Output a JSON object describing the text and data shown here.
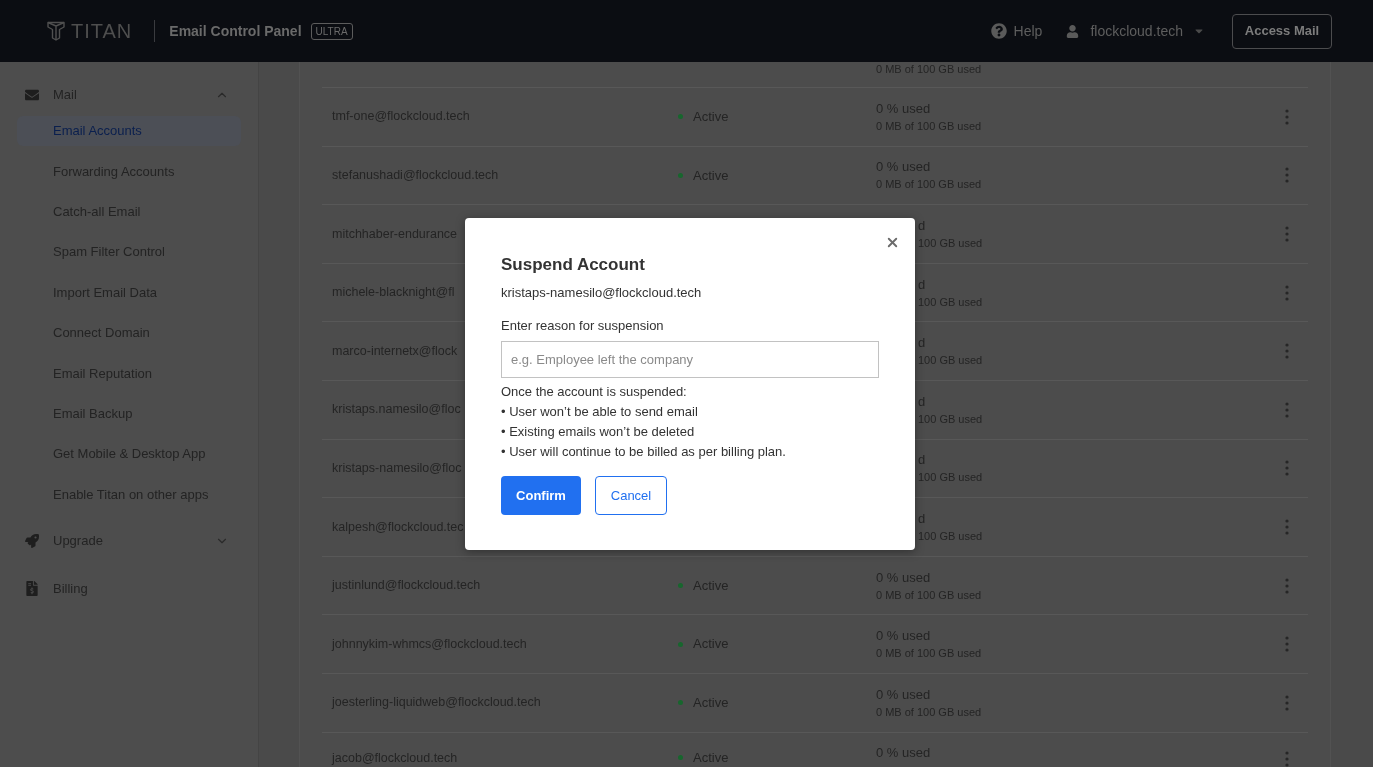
{
  "header": {
    "logo": {
      "text": "TITAN"
    },
    "title": "Email Control Panel",
    "badge": "ULTRA",
    "help": "Help",
    "account": "flockcloud.tech",
    "action": "Access Mail"
  },
  "sidebar": {
    "sections": [
      {
        "label": "Mail",
        "expanded": true,
        "items": [
          {
            "label": "Email Accounts",
            "selected": true
          },
          {
            "label": "Forwarding Accounts",
            "selected": false
          },
          {
            "label": "Catch-all Email",
            "selected": false
          },
          {
            "label": "Spam Filter Control",
            "selected": false
          },
          {
            "label": "Import Email Data",
            "selected": false
          },
          {
            "label": "Connect Domain",
            "selected": false
          },
          {
            "label": "Email Reputation",
            "selected": false
          },
          {
            "label": "Email Backup",
            "selected": false
          },
          {
            "label": "Get Mobile & Desktop App",
            "selected": false
          },
          {
            "label": "Enable Titan on other apps",
            "selected": false
          }
        ]
      },
      {
        "label": "Upgrade",
        "expanded": false
      },
      {
        "label": "Billing"
      }
    ]
  },
  "table": {
    "rows": [
      {
        "kind": "cut_top",
        "usage_detail": "0 MB of 100 GB used"
      },
      {
        "kind": "full",
        "email": "tmf-one@flockcloud.tech",
        "status": "Active",
        "usage": "0 % used",
        "usage_detail": "0 MB of 100 GB used"
      },
      {
        "kind": "full",
        "email": "stefanushadi@flockcloud.tech",
        "status": "Active",
        "usage": "0 % used",
        "usage_detail": "0 MB of 100 GB used"
      },
      {
        "kind": "covered",
        "email": "mitchhaber-endurance",
        "usage": "d",
        "usage_detail": "100 GB used"
      },
      {
        "kind": "covered",
        "email": "michele-blacknight@fl",
        "usage": "d",
        "usage_detail": "100 GB used"
      },
      {
        "kind": "covered",
        "email": "marco-internetx@flock",
        "usage": "d",
        "usage_detail": "100 GB used"
      },
      {
        "kind": "covered",
        "email": "kristaps.namesilo@floc",
        "usage": "d",
        "usage_detail": "100 GB used"
      },
      {
        "kind": "covered",
        "email": "kristaps-namesilo@floc",
        "usage": "d",
        "usage_detail": "100 GB used"
      },
      {
        "kind": "covered",
        "email": "kalpesh@flockcloud.tec",
        "usage": "d",
        "usage_detail": "100 GB used"
      },
      {
        "kind": "full",
        "email": "justinlund@flockcloud.tech",
        "status": "Active",
        "usage": "0 % used",
        "usage_detail": "0 MB of 100 GB used"
      },
      {
        "kind": "full",
        "email": "johnnykim-whmcs@flockcloud.tech",
        "status": "Active",
        "usage": "0 % used",
        "usage_detail": "0 MB of 100 GB used"
      },
      {
        "kind": "full",
        "email": "joesterling-liquidweb@flockcloud.tech",
        "status": "Active",
        "usage": "0 % used",
        "usage_detail": "0 MB of 100 GB used"
      },
      {
        "kind": "cut_bottom",
        "email": "jacob@flockcloud.tech",
        "status": "Active",
        "usage": "0 % used"
      }
    ]
  },
  "dialog": {
    "title": "Suspend Account",
    "account": "kristaps-namesilo@flockcloud.tech",
    "reason_label": "Enter reason for suspension",
    "reason_placeholder": "e.g. Employee left the company",
    "notes": [
      "Once the account is suspended:",
      "• User won’t be able to send email",
      "• Existing emails won’t be deleted",
      "• User will continue to be billed as per billing plan."
    ],
    "buttons": [
      {
        "label": "Confirm",
        "kind": "primary"
      },
      {
        "label": "Cancel",
        "kind": "secondary"
      }
    ]
  }
}
